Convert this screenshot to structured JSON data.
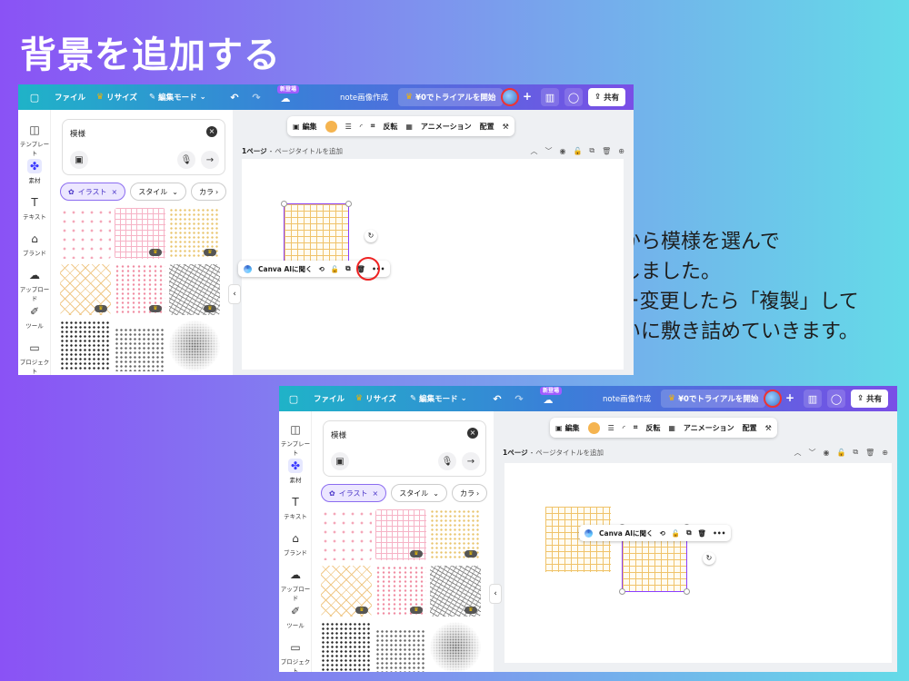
{
  "slide": {
    "title": "背景を追加する",
    "caption_lines": [
      "今回は素材から模様を選んで",
      "全体に配置しました。",
      "ひとつカラー変更したら「複製」して",
      "画面いっぱいに敷き詰めていきます。"
    ]
  },
  "ui": {
    "topbar": {
      "file": "ファイル",
      "resize": "リサイズ",
      "edit_mode": "編集モード",
      "new_badge": "新登場",
      "doc_title": "note画像作成",
      "trial": "¥0でトライアルを開始",
      "share": "共有"
    },
    "rail": {
      "template": "テンプレート",
      "elements": "素材",
      "text": "テキスト",
      "brand": "ブランド",
      "upload": "アップロード",
      "tools": "ツール",
      "projects": "プロジェクト"
    },
    "panel": {
      "search_value": "模様",
      "chip_illust": "イラスト",
      "chip_style": "スタイル",
      "chip_color": "カラ"
    },
    "context_bar": {
      "edit": "編集",
      "flip": "反転",
      "animate": "アニメーション",
      "position": "配置"
    },
    "page_bar": {
      "page_label": "1ページ",
      "page_title_placeholder": "ページタイトルを追加"
    },
    "float_bar": {
      "canva_ai": "Canva AIに聞く"
    }
  },
  "colors": {
    "brand_purple": "#8b3dff",
    "highlight_red": "#e22222",
    "swatch_orange": "#f5b450"
  }
}
